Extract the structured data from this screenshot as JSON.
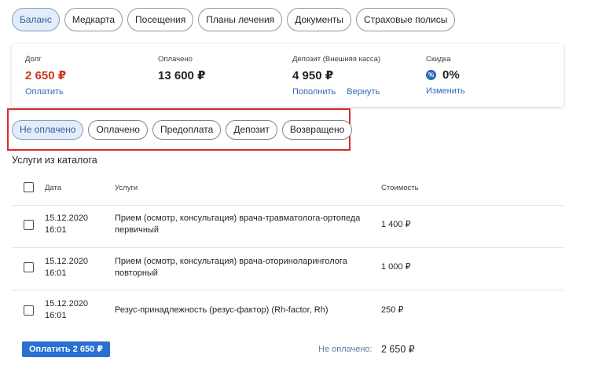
{
  "tabs": [
    {
      "label": "Баланс",
      "active": true
    },
    {
      "label": "Медкарта",
      "active": false
    },
    {
      "label": "Посещения",
      "active": false
    },
    {
      "label": "Планы лечения",
      "active": false
    },
    {
      "label": "Документы",
      "active": false
    },
    {
      "label": "Страховые полисы",
      "active": false
    }
  ],
  "summary": {
    "debt": {
      "label": "Долг",
      "value": "2 650 ₽",
      "link": "Оплатить"
    },
    "paid": {
      "label": "Оплачено",
      "value": "13 600 ₽"
    },
    "deposit": {
      "label": "Депозит (Внешняя касса)",
      "value": "4 950 ₽",
      "link_add": "Пополнить",
      "link_return": "Вернуть"
    },
    "discount": {
      "label": "Скидка",
      "value": "0%",
      "icon": "percent-icon",
      "link": "Изменить"
    }
  },
  "filters": [
    {
      "label": "Не оплачено",
      "active": true
    },
    {
      "label": "Оплачено",
      "active": false
    },
    {
      "label": "Предоплата",
      "active": false
    },
    {
      "label": "Депозит",
      "active": false
    },
    {
      "label": "Возвращено",
      "active": false
    }
  ],
  "section_title": "Услуги из каталога",
  "table": {
    "headers": {
      "date": "Дата",
      "service": "Услуги",
      "price": "Стоимость"
    },
    "rows": [
      {
        "date": "15.12.2020",
        "time": "16:01",
        "service": "Прием (осмотр, консультация) врача-травматолога-ортопеда первичный",
        "price": "1 400 ₽"
      },
      {
        "date": "15.12.2020",
        "time": "16:01",
        "service": "Прием (осмотр, консультация) врача-оториноларинголога повторный",
        "price": "1 000 ₽"
      },
      {
        "date": "15.12.2020",
        "time": "16:01",
        "service": "Резус-принадлежность (резус-фактор) (Rh-factor, Rh)",
        "price": "250 ₽"
      }
    ]
  },
  "footer": {
    "pay_button": "Оплатить 2 650 ₽",
    "unpaid_label": "Не оплачено:",
    "unpaid_value": "2 650 ₽"
  },
  "colors": {
    "accent": "#2a6fd1",
    "debt": "#d0331f",
    "highlight_box": "#d22c2c"
  }
}
